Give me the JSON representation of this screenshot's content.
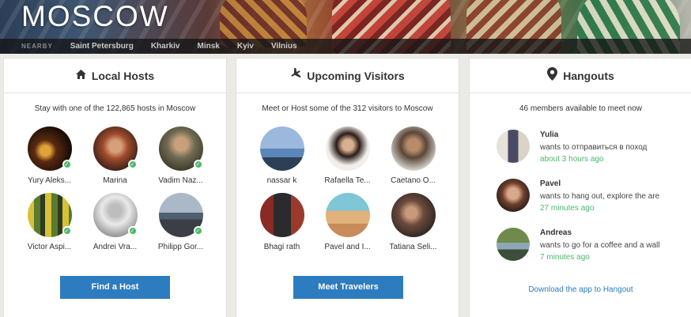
{
  "hero": {
    "title": "MOSCOW",
    "nearby_label": "NEARBY",
    "cities": [
      "Saint Petersburg",
      "Kharkiv",
      "Minsk",
      "Kyiv",
      "Vilnius"
    ]
  },
  "local_hosts": {
    "title": "Local Hosts",
    "subtitle": "Stay with one of the 122,865 hosts in Moscow",
    "people": [
      {
        "name": "Yury Aleks...",
        "verified": true
      },
      {
        "name": "Marina",
        "verified": true
      },
      {
        "name": "Vadim Naz...",
        "verified": true
      },
      {
        "name": "Victor Aspi...",
        "verified": true
      },
      {
        "name": "Andrei Vra...",
        "verified": true
      },
      {
        "name": "Philipp Gor...",
        "verified": true
      }
    ],
    "button": "Find a Host"
  },
  "upcoming_visitors": {
    "title": "Upcoming Visitors",
    "subtitle": "Meet or Host some of the 312 visitors to Moscow",
    "people": [
      {
        "name": "nassar k"
      },
      {
        "name": "Rafaella Te..."
      },
      {
        "name": "Caetano O..."
      },
      {
        "name": "Bhagi rath"
      },
      {
        "name": "Pavel and I..."
      },
      {
        "name": "Tatiana Seli..."
      }
    ],
    "button": "Meet Travelers"
  },
  "hangouts": {
    "title": "Hangouts",
    "subtitle": "46 members available to meet now",
    "members": [
      {
        "name": "Yulia",
        "message": "wants to отправиться в поход",
        "time": "about 3 hours ago"
      },
      {
        "name": "Pavel",
        "message": "wants to hang out, explore the are",
        "time": "27 minutes ago"
      },
      {
        "name": "Andreas",
        "message": "wants to go for a coffee and a wall",
        "time": "7 minutes ago"
      }
    ],
    "link": "Download the app to Hangout"
  },
  "colors": {
    "accent": "#2d7cc0",
    "verified": "#4cb86a",
    "time_text": "#4cb86a"
  },
  "icons": {
    "local_hosts": "house-icon",
    "upcoming_visitors": "airplane-icon",
    "hangouts": "map-pin-icon"
  }
}
